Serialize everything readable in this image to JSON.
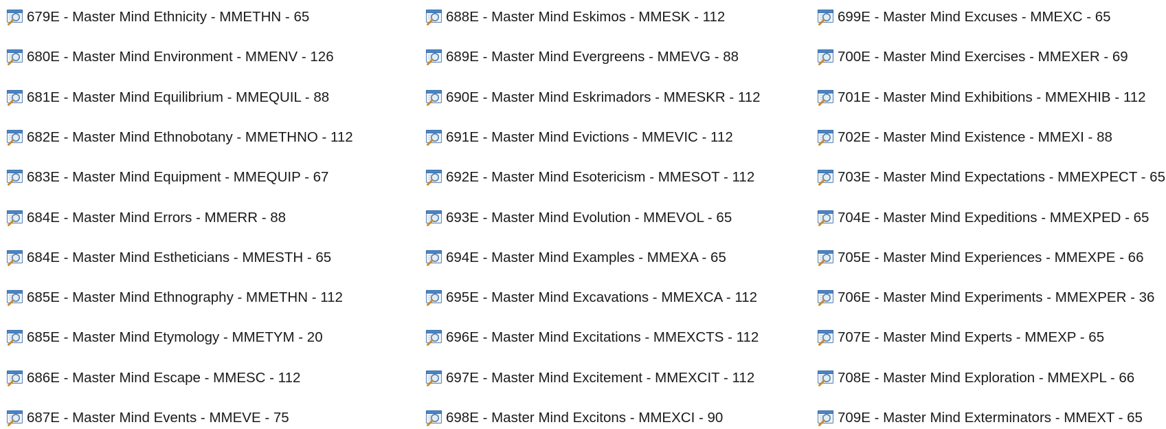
{
  "columns": [
    {
      "items": [
        {
          "icon": "search-file-icon",
          "label": "679E - Master Mind Ethnicity - MMETHN - 65"
        },
        {
          "icon": "search-file-icon",
          "label": "680E - Master Mind Environment - MMENV - 126"
        },
        {
          "icon": "search-file-icon",
          "label": "681E - Master Mind Equilibrium - MMEQUIL - 88"
        },
        {
          "icon": "search-file-icon",
          "label": "682E - Master Mind Ethnobotany - MMETHNO - 112"
        },
        {
          "icon": "search-file-icon",
          "label": "683E - Master Mind Equipment - MMEQUIP - 67"
        },
        {
          "icon": "search-file-icon",
          "label": "684E - Master Mind Errors - MMERR - 88"
        },
        {
          "icon": "search-file-icon",
          "label": "684E - Master Mind Estheticians - MMESTH - 65"
        },
        {
          "icon": "search-file-icon",
          "label": "685E - Master Mind Ethnography - MMETHN - 112"
        },
        {
          "icon": "search-file-icon",
          "label": "685E - Master Mind Etymology - MMETYM - 20"
        },
        {
          "icon": "search-file-icon",
          "label": "686E - Master Mind Escape - MMESC - 112"
        },
        {
          "icon": "search-file-icon",
          "label": "687E - Master Mind Events - MMEVE - 75"
        }
      ]
    },
    {
      "items": [
        {
          "icon": "search-file-icon",
          "label": "688E - Master Mind Eskimos - MMESK - 112"
        },
        {
          "icon": "search-file-icon",
          "label": "689E - Master Mind Evergreens - MMEVG - 88"
        },
        {
          "icon": "search-file-icon",
          "label": "690E - Master Mind Eskrimadors - MMESKR - 112"
        },
        {
          "icon": "search-file-icon",
          "label": "691E - Master Mind Evictions - MMEVIC - 112"
        },
        {
          "icon": "search-file-icon",
          "label": "692E - Master Mind Esotericism - MMESOT - 112"
        },
        {
          "icon": "search-file-icon",
          "label": "693E - Master Mind Evolution - MMEVOL - 65"
        },
        {
          "icon": "search-file-icon",
          "label": "694E - Master Mind Examples - MMEXA - 65"
        },
        {
          "icon": "search-file-icon",
          "label": "695E - Master Mind Excavations - MMEXCA - 112"
        },
        {
          "icon": "search-file-icon",
          "label": "696E - Master Mind Excitations - MMEXCTS - 112"
        },
        {
          "icon": "search-file-icon",
          "label": "697E - Master Mind Excitement - MMEXCIT - 112"
        },
        {
          "icon": "search-file-icon",
          "label": "698E - Master Mind Excitons - MMEXCI - 90"
        }
      ]
    },
    {
      "items": [
        {
          "icon": "search-file-icon",
          "label": "699E - Master Mind Excuses - MMEXC - 65"
        },
        {
          "icon": "search-file-icon",
          "label": "700E - Master Mind Exercises - MMEXER - 69"
        },
        {
          "icon": "search-file-icon",
          "label": "701E - Master Mind Exhibitions - MMEXHIB - 112"
        },
        {
          "icon": "search-file-icon",
          "label": "702E - Master Mind Existence - MMEXI - 88"
        },
        {
          "icon": "search-file-icon",
          "label": "703E - Master Mind Expectations - MMEXPECT - 65"
        },
        {
          "icon": "search-file-icon",
          "label": "704E - Master Mind Expeditions - MMEXPED - 65"
        },
        {
          "icon": "search-file-icon",
          "label": "705E - Master Mind Experiences - MMEXPE - 66"
        },
        {
          "icon": "search-file-icon",
          "label": "706E - Master Mind Experiments - MMEXPER - 36"
        },
        {
          "icon": "search-file-icon",
          "label": "707E - Master Mind Experts - MMEXP - 65"
        },
        {
          "icon": "search-file-icon",
          "label": "708E - Master Mind Exploration - MMEXPL - 66"
        },
        {
          "icon": "search-file-icon",
          "label": "709E - Master Mind Exterminators - MMEXT - 65"
        }
      ]
    }
  ]
}
